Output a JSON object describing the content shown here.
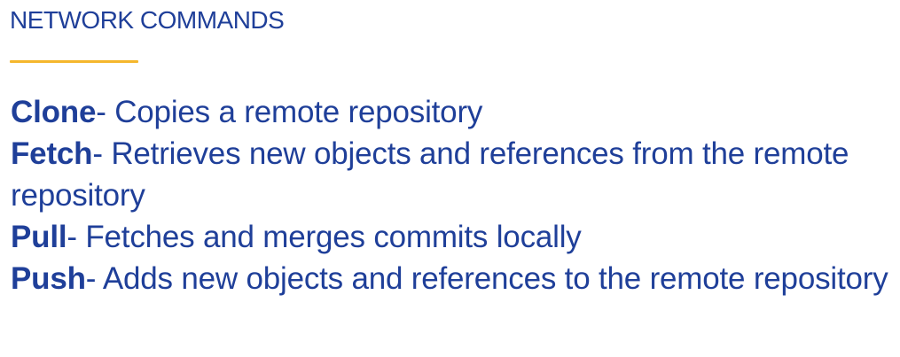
{
  "colors": {
    "text": "#1f3f99",
    "accent": "#f5b72d",
    "background": "#ffffff"
  },
  "slide": {
    "title": "NETWORK COMMANDS",
    "commands": [
      {
        "name": "Clone",
        "description": "- Copies a remote repository"
      },
      {
        "name": "Fetch",
        "description": "- Retrieves new objects and references from the remote repository"
      },
      {
        "name": "Pull",
        "description": "- Fetches and merges commits locally"
      },
      {
        "name": "Push",
        "description": "- Adds new objects and references to the remote repository"
      }
    ]
  }
}
